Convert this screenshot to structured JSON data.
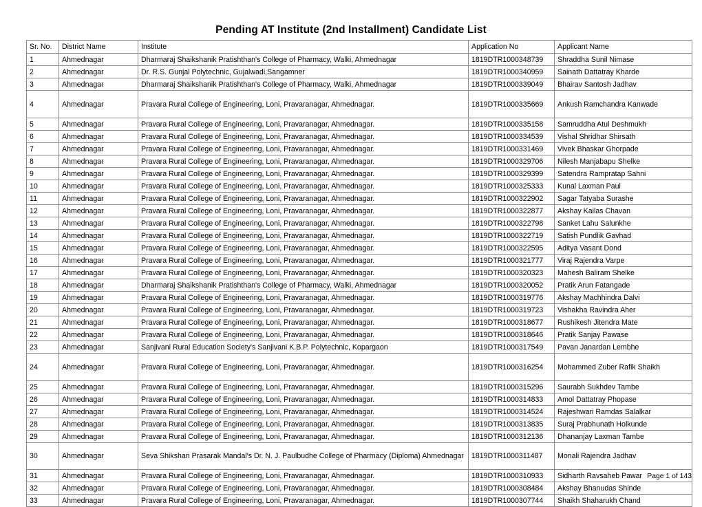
{
  "document": {
    "title": "Pending AT Institute (2nd Installment) Candidate List",
    "footer": "Page 1 of 143"
  },
  "table": {
    "columns": [
      {
        "key": "sr",
        "label": "Sr. No."
      },
      {
        "key": "district",
        "label": "District Name"
      },
      {
        "key": "institute",
        "label": "Institute"
      },
      {
        "key": "application_no",
        "label": "Application No"
      },
      {
        "key": "applicant_name",
        "label": "Applicant Name"
      }
    ],
    "rows": [
      {
        "sr": "1",
        "district": "Ahmednagar",
        "institute": "Dharmaraj Shaikshanik Pratishthan's College of Pharmacy, Walki, Ahmednagar",
        "application_no": "1819DTR1000348739",
        "applicant_name": "Shraddha Sunil Nimase",
        "height": "normal"
      },
      {
        "sr": "2",
        "district": "Ahmednagar",
        "institute": "Dr. R.S. Gunjal Polytechnic, Gujalwadi,Sangamner",
        "application_no": "1819DTR1000340959",
        "applicant_name": "Sainath Dattatray Kharde",
        "height": "normal"
      },
      {
        "sr": "3",
        "district": "Ahmednagar",
        "institute": "Dharmaraj Shaikshanik Pratishthan's College of Pharmacy, Walki, Ahmednagar",
        "application_no": "1819DTR1000339049",
        "applicant_name": "Bhairav Santosh Jadhav",
        "height": "normal"
      },
      {
        "sr": "4",
        "district": "Ahmednagar",
        "institute": "Pravara Rural College of Engineering, Loni, Pravaranagar, Ahmednagar.",
        "application_no": "1819DTR1000335669",
        "applicant_name": "Ankush Ramchandra Kanwade",
        "height": "tall"
      },
      {
        "sr": "5",
        "district": "Ahmednagar",
        "institute": "Pravara Rural College of Engineering, Loni, Pravaranagar, Ahmednagar.",
        "application_no": "1819DTR1000335158",
        "applicant_name": "Samruddha Atul Deshmukh",
        "height": "normal"
      },
      {
        "sr": "6",
        "district": "Ahmednagar",
        "institute": "Pravara Rural College of Engineering, Loni, Pravaranagar, Ahmednagar.",
        "application_no": "1819DTR1000334539",
        "applicant_name": "Vishal Shridhar Shirsath",
        "height": "normal"
      },
      {
        "sr": "7",
        "district": "Ahmednagar",
        "institute": "Pravara Rural College of Engineering, Loni, Pravaranagar, Ahmednagar.",
        "application_no": "1819DTR1000331469",
        "applicant_name": "Vivek Bhaskar Ghorpade",
        "height": "normal"
      },
      {
        "sr": "8",
        "district": "Ahmednagar",
        "institute": "Pravara Rural College of Engineering, Loni, Pravaranagar, Ahmednagar.",
        "application_no": "1819DTR1000329706",
        "applicant_name": "Nilesh Manjabapu Shelke",
        "height": "normal"
      },
      {
        "sr": "9",
        "district": "Ahmednagar",
        "institute": "Pravara Rural College of Engineering, Loni, Pravaranagar, Ahmednagar.",
        "application_no": "1819DTR1000329399",
        "applicant_name": "Satendra Rampratap Sahni",
        "height": "normal"
      },
      {
        "sr": "10",
        "district": "Ahmednagar",
        "institute": "Pravara Rural College of Engineering, Loni, Pravaranagar, Ahmednagar.",
        "application_no": "1819DTR1000325333",
        "applicant_name": "Kunal Laxman Paul",
        "height": "normal"
      },
      {
        "sr": "11",
        "district": "Ahmednagar",
        "institute": "Pravara Rural College of Engineering, Loni, Pravaranagar, Ahmednagar.",
        "application_no": "1819DTR1000322902",
        "applicant_name": "Sagar Tatyaba Surashe",
        "height": "normal"
      },
      {
        "sr": "12",
        "district": "Ahmednagar",
        "institute": "Pravara Rural College of Engineering, Loni, Pravaranagar, Ahmednagar.",
        "application_no": "1819DTR1000322877",
        "applicant_name": "Akshay Kailas Chavan",
        "height": "normal"
      },
      {
        "sr": "13",
        "district": "Ahmednagar",
        "institute": "Pravara Rural College of Engineering, Loni, Pravaranagar, Ahmednagar.",
        "application_no": "1819DTR1000322798",
        "applicant_name": "Sanket Lahu Salunkhe",
        "height": "normal"
      },
      {
        "sr": "14",
        "district": "Ahmednagar",
        "institute": "Pravara Rural College of Engineering, Loni, Pravaranagar, Ahmednagar.",
        "application_no": "1819DTR1000322719",
        "applicant_name": "Satish Pundlik Gavhad",
        "height": "normal"
      },
      {
        "sr": "15",
        "district": "Ahmednagar",
        "institute": "Pravara Rural College of Engineering, Loni, Pravaranagar, Ahmednagar.",
        "application_no": "1819DTR1000322595",
        "applicant_name": "Aditya Vasant Dond",
        "height": "normal"
      },
      {
        "sr": "16",
        "district": "Ahmednagar",
        "institute": "Pravara Rural College of Engineering, Loni, Pravaranagar, Ahmednagar.",
        "application_no": "1819DTR1000321777",
        "applicant_name": "Viraj Rajendra Varpe",
        "height": "normal"
      },
      {
        "sr": "17",
        "district": "Ahmednagar",
        "institute": "Pravara Rural College of Engineering, Loni, Pravaranagar, Ahmednagar.",
        "application_no": "1819DTR1000320323",
        "applicant_name": "Mahesh Baliram Shelke",
        "height": "normal"
      },
      {
        "sr": "18",
        "district": "Ahmednagar",
        "institute": "Dharmaraj Shaikshanik Pratishthan's College of Pharmacy, Walki, Ahmednagar",
        "application_no": "1819DTR1000320052",
        "applicant_name": "Pratik Arun Fatangade",
        "height": "normal"
      },
      {
        "sr": "19",
        "district": "Ahmednagar",
        "institute": "Pravara Rural College of Engineering, Loni, Pravaranagar, Ahmednagar.",
        "application_no": "1819DTR1000319776",
        "applicant_name": "Akshay Machhindra Dalvi",
        "height": "normal"
      },
      {
        "sr": "20",
        "district": "Ahmednagar",
        "institute": "Pravara Rural College of Engineering, Loni, Pravaranagar, Ahmednagar.",
        "application_no": "1819DTR1000319723",
        "applicant_name": "Vishakha Ravindra Aher",
        "height": "normal"
      },
      {
        "sr": "21",
        "district": "Ahmednagar",
        "institute": "Pravara Rural College of Engineering, Loni, Pravaranagar, Ahmednagar.",
        "application_no": "1819DTR1000318677",
        "applicant_name": "Rushikesh Jitendra Mate",
        "height": "normal"
      },
      {
        "sr": "22",
        "district": "Ahmednagar",
        "institute": "Pravara Rural College of Engineering, Loni, Pravaranagar, Ahmednagar.",
        "application_no": "1819DTR1000318646",
        "applicant_name": "Pratik Sanjay Pawase",
        "height": "normal"
      },
      {
        "sr": "23",
        "district": "Ahmednagar",
        "institute": "Sanjivani Rural Education Society's Sanjivani K.B.P. Polytechnic, Kopargaon",
        "application_no": "1819DTR1000317549",
        "applicant_name": "Pavan Janardan Lembhe",
        "height": "normal"
      },
      {
        "sr": "24",
        "district": "Ahmednagar",
        "institute": "Pravara Rural College of Engineering, Loni, Pravaranagar, Ahmednagar.",
        "application_no": "1819DTR1000316254",
        "applicant_name": "Mohammed Zuber Rafik Shaikh",
        "height": "tall"
      },
      {
        "sr": "25",
        "district": "Ahmednagar",
        "institute": "Pravara Rural College of Engineering, Loni, Pravaranagar, Ahmednagar.",
        "application_no": "1819DTR1000315296",
        "applicant_name": "Saurabh Sukhdev Tambe",
        "height": "normal"
      },
      {
        "sr": "26",
        "district": "Ahmednagar",
        "institute": "Pravara Rural College of Engineering, Loni, Pravaranagar, Ahmednagar.",
        "application_no": "1819DTR1000314833",
        "applicant_name": "Amol Dattatray Phopase",
        "height": "normal"
      },
      {
        "sr": "27",
        "district": "Ahmednagar",
        "institute": "Pravara Rural College of Engineering, Loni, Pravaranagar, Ahmednagar.",
        "application_no": "1819DTR1000314524",
        "applicant_name": "Rajeshwari Ramdas Salalkar",
        "height": "normal"
      },
      {
        "sr": "28",
        "district": "Ahmednagar",
        "institute": "Pravara Rural College of Engineering, Loni, Pravaranagar, Ahmednagar.",
        "application_no": "1819DTR1000313835",
        "applicant_name": "Suraj Prabhunath Holkunde",
        "height": "normal"
      },
      {
        "sr": "29",
        "district": "Ahmednagar",
        "institute": "Pravara Rural College of Engineering, Loni, Pravaranagar, Ahmednagar.",
        "application_no": "1819DTR1000312136",
        "applicant_name": "Dhananjay Laxman Tambe",
        "height": "normal"
      },
      {
        "sr": "30",
        "district": "Ahmednagar",
        "institute": "Seva Shikshan Prasarak Mandal's Dr. N. J. Paulbudhe College of Pharmacy (Diploma) Ahmednagar",
        "application_no": "1819DTR1000311487",
        "applicant_name": "Monali Rajendra Jadhav",
        "height": "wrap2"
      },
      {
        "sr": "31",
        "district": "Ahmednagar",
        "institute": "Pravara Rural College of Engineering, Loni, Pravaranagar, Ahmednagar.",
        "application_no": "1819DTR1000310933",
        "applicant_name": "Sidharth Ravsaheb Pawar",
        "height": "normal"
      },
      {
        "sr": "32",
        "district": "Ahmednagar",
        "institute": "Pravara Rural College of Engineering, Loni, Pravaranagar, Ahmednagar.",
        "application_no": "1819DTR1000308484",
        "applicant_name": "Akshay Bhanudas Shinde",
        "height": "normal"
      },
      {
        "sr": "33",
        "district": "Ahmednagar",
        "institute": "Pravara Rural College of Engineering, Loni, Pravaranagar, Ahmednagar.",
        "application_no": "1819DTR1000307744",
        "applicant_name": "Shaikh Shaharukh Chand",
        "height": "normal"
      }
    ]
  },
  "colors": {
    "text": "#000000",
    "border": "#8a8a8a",
    "background": "#ffffff"
  }
}
